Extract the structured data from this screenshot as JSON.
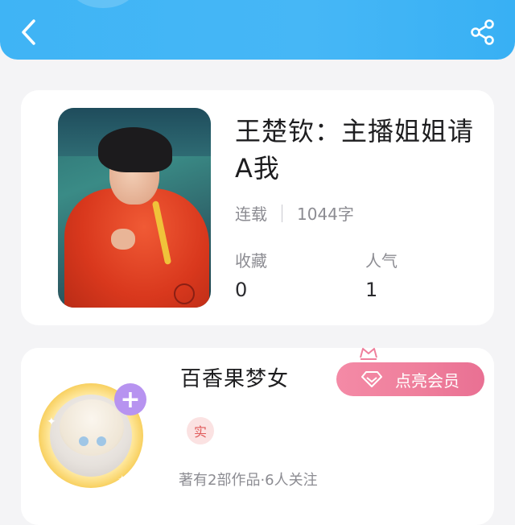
{
  "header": {
    "back_icon": "chevron-left-icon",
    "share_icon": "share-icon",
    "color": "#41b5f5"
  },
  "book": {
    "title": "王楚钦：主播姐姐请A我",
    "status": "连载",
    "word_count": "1044字",
    "stats": [
      {
        "label": "收藏",
        "value": "0"
      },
      {
        "label": "人气",
        "value": "1"
      }
    ]
  },
  "author": {
    "name": "百香果梦女",
    "vip_button_label": "点亮会员",
    "real_badge": "实",
    "meta": "著有2部作品·6人关注",
    "follow_icon": "plus-icon",
    "accent": "#ef7f9c"
  }
}
